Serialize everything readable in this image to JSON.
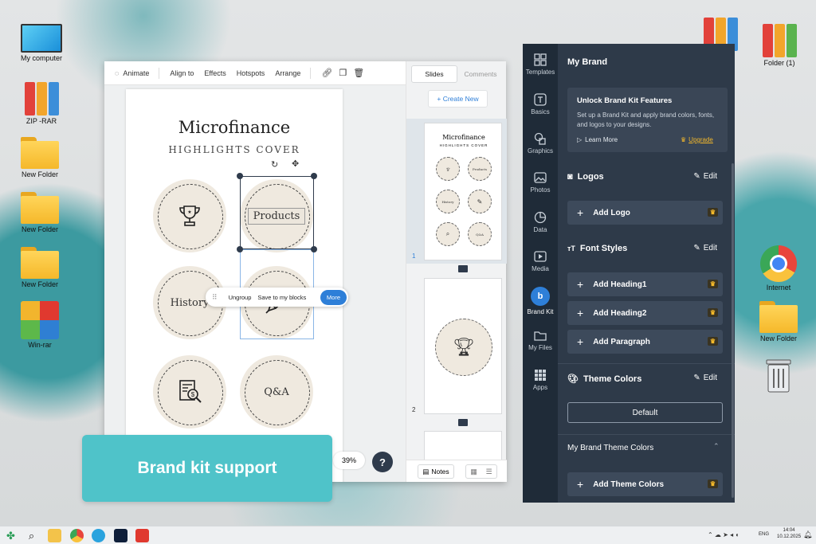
{
  "desktop": {
    "icons_left": [
      {
        "label": "My computer",
        "type": "monitor"
      },
      {
        "label": "ZIP -RAR",
        "type": "binders"
      },
      {
        "label": "New Folder",
        "type": "folder"
      },
      {
        "label": "New Folder",
        "type": "folder"
      },
      {
        "label": "New Folder",
        "type": "folder"
      },
      {
        "label": "Win-rar",
        "type": "winrar"
      }
    ],
    "icons_right": [
      {
        "label": "Folder (1)",
        "type": "binders"
      },
      {
        "label": "Internet",
        "type": "chrome"
      },
      {
        "label": "New Folder",
        "type": "folder"
      },
      {
        "label": "",
        "type": "trash"
      }
    ]
  },
  "toolbar": {
    "animate": "Animate",
    "align": "Align to",
    "effects": "Effects",
    "hotspots": "Hotspots",
    "arrange": "Arrange",
    "icons": [
      "link-icon",
      "copy-icon",
      "trash-icon"
    ]
  },
  "canvas": {
    "title": "Microfinance",
    "subtitle": "HIGHLIGHTS COVER",
    "circles": [
      {
        "label": "",
        "icon": "trophy-icon"
      },
      {
        "label": "Products",
        "icon": ""
      },
      {
        "label": "History",
        "icon": ""
      },
      {
        "label": "",
        "icon": "pencil-icon"
      },
      {
        "label": "",
        "icon": "document-search-icon"
      },
      {
        "label": "Q&A",
        "icon": ""
      }
    ],
    "context_menu": {
      "ungroup": "Ungroup",
      "save": "Save to my blocks",
      "more": "More"
    },
    "zoom": "39%",
    "help": "?"
  },
  "slides_panel": {
    "tab_slides": "Slides",
    "tab_comments": "Comments",
    "create_new": "+ Create New",
    "slide_numbers": [
      "1",
      "2"
    ],
    "notes": "Notes"
  },
  "banner": {
    "text": "Brand kit support",
    "color": "#4fc3c9"
  },
  "sidebar": {
    "items": [
      {
        "label": "Templates",
        "icon": "templates-icon"
      },
      {
        "label": "Basics",
        "icon": "text-icon"
      },
      {
        "label": "Graphics",
        "icon": "graphics-icon"
      },
      {
        "label": "Photos",
        "icon": "photos-icon"
      },
      {
        "label": "Data",
        "icon": "pie-chart-icon"
      },
      {
        "label": "Media",
        "icon": "media-icon"
      },
      {
        "label": "Brand Kit",
        "icon": "brand-kit-icon"
      },
      {
        "label": "My Files",
        "icon": "folder-icon"
      },
      {
        "label": "Apps",
        "icon": "apps-icon"
      }
    ]
  },
  "brand": {
    "title": "My Brand",
    "unlock": {
      "title": "Unlock Brand Kit Features",
      "text": "Set up a Brand Kit and apply brand colors, fonts, and logos to your designs.",
      "learn": "Learn More",
      "upgrade": "Upgrade"
    },
    "logos": {
      "title": "Logos",
      "edit": "Edit",
      "add": "Add Logo"
    },
    "fonts": {
      "title": "Font Styles",
      "edit": "Edit",
      "h1": "Add Heading1",
      "h2": "Add Heading2",
      "p": "Add Paragraph"
    },
    "theme": {
      "title": "Theme Colors",
      "edit": "Edit",
      "default": "Default"
    },
    "my_theme": {
      "title": "My Brand Theme Colors",
      "add": "Add Theme Colors"
    }
  },
  "taskbar": {
    "lang": "ENG",
    "time": "14:04",
    "date": "10.12.2025"
  }
}
